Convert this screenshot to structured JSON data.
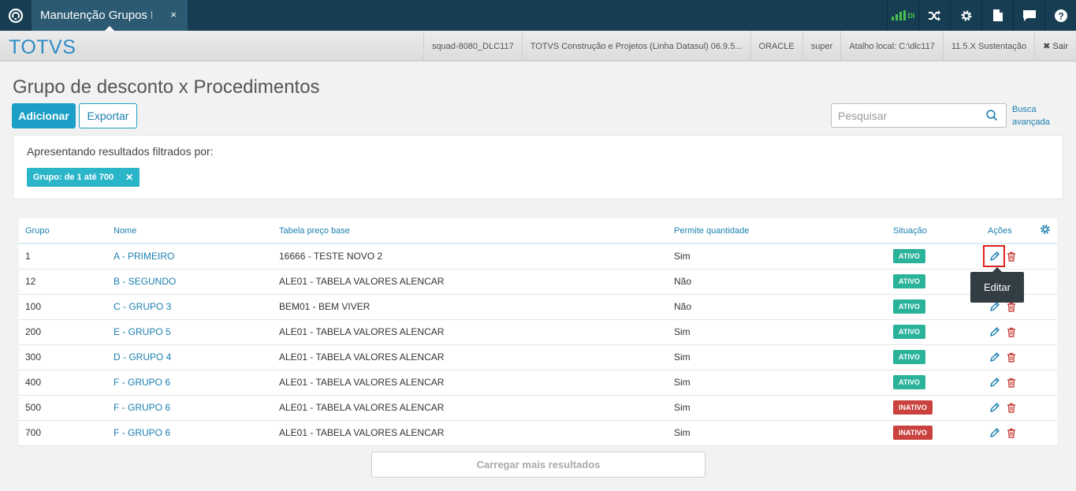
{
  "topbar": {
    "tab_label": "Manutenção Grupos D",
    "tab_close": "×",
    "signal_text": "DI",
    "icons": [
      "totvs-logo-icon",
      "signal-icon",
      "shuffle-icon",
      "gear-icon",
      "document-icon",
      "chat-icon",
      "help-icon"
    ]
  },
  "header": {
    "brand": "TOTVS",
    "info": [
      "squad-8080_DLC117",
      "TOTVS Construção e Projetos (Linha Datasul) 06.9.5...",
      "ORACLE",
      "super",
      "Atalho local: C:\\dlc117",
      "11.5.X Sustentação"
    ],
    "exit_label": "✖ Sair"
  },
  "page": {
    "title": "Grupo de desconto x Procedimentos",
    "add_label": "Adicionar",
    "export_label": "Exportar",
    "search_placeholder": "Pesquisar",
    "adv_search_line1": "Busca",
    "adv_search_line2": "avançada"
  },
  "filter": {
    "title": "Apresentando resultados filtrados por:",
    "chip_label": "Grupo: de 1 até 700",
    "chip_close": "✕"
  },
  "table": {
    "columns": [
      "Grupo",
      "Nome",
      "Tabela preço base",
      "Permite quantidade",
      "Situação",
      "Ações"
    ],
    "rows": [
      {
        "grupo": "1",
        "nome": "A - PRIMEIRO",
        "tabela": "16666 - TESTE NOVO 2",
        "permite": "Sim",
        "situacao": "ATIVO"
      },
      {
        "grupo": "12",
        "nome": "B - SEGUNDO",
        "tabela": "ALE01 - TABELA VALORES ALENCAR",
        "permite": "Não",
        "situacao": "ATIVO"
      },
      {
        "grupo": "100",
        "nome": "C - GRUPO 3",
        "tabela": "BEM01 - BEM VIVER",
        "permite": "Não",
        "situacao": "ATIVO"
      },
      {
        "grupo": "200",
        "nome": "E - GRUPO 5",
        "tabela": "ALE01 - TABELA VALORES ALENCAR",
        "permite": "Sim",
        "situacao": "ATIVO"
      },
      {
        "grupo": "300",
        "nome": "D - GRUPO 4",
        "tabela": "ALE01 - TABELA VALORES ALENCAR",
        "permite": "Sim",
        "situacao": "ATIVO"
      },
      {
        "grupo": "400",
        "nome": "F - GRUPO 6",
        "tabela": "ALE01 - TABELA VALORES ALENCAR",
        "permite": "Sim",
        "situacao": "ATIVO"
      },
      {
        "grupo": "500",
        "nome": "F - GRUPO 6",
        "tabela": "ALE01 - TABELA VALORES ALENCAR",
        "permite": "Sim",
        "situacao": "INATIVO"
      },
      {
        "grupo": "700",
        "nome": "F - GRUPO 6",
        "tabela": "ALE01 - TABELA VALORES ALENCAR",
        "permite": "Sim",
        "situacao": "INATIVO"
      }
    ],
    "status_colors": {
      "ATIVO": "#2bb39a",
      "INATIVO": "#c9423d"
    }
  },
  "tooltip": {
    "text": "Editar"
  },
  "load_more_label": "Carregar mais resultados"
}
